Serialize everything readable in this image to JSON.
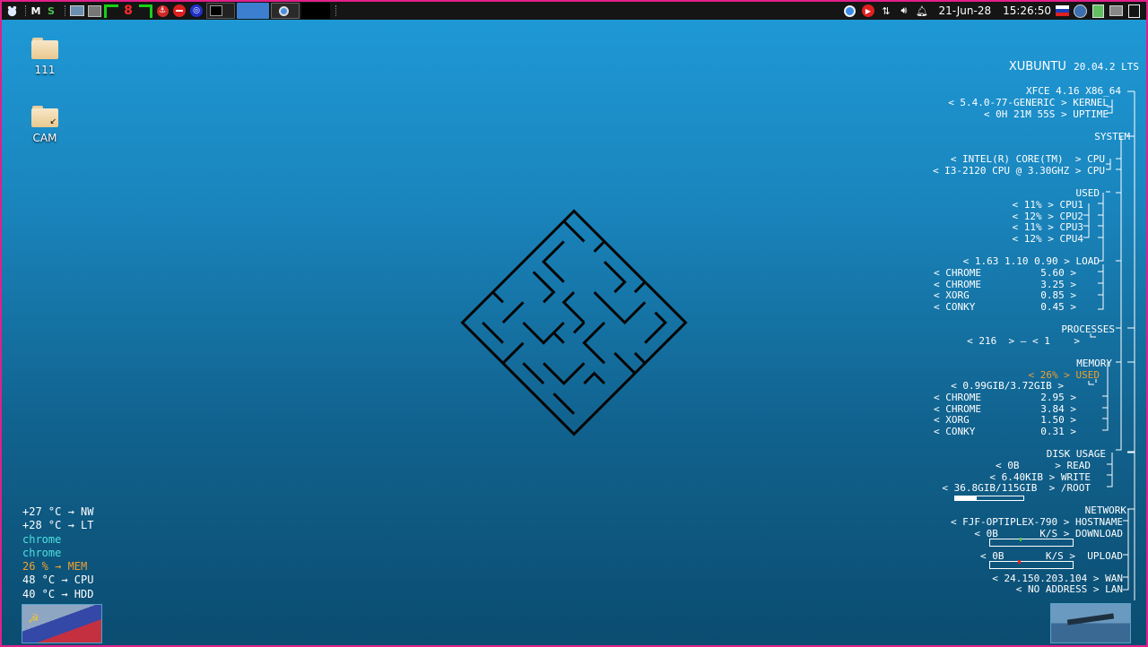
{
  "panel": {
    "menu_icon": "xfce-mouse-icon",
    "launcher_text": "M",
    "clock_date": "21-Jun-28",
    "clock_time": "15:26:50",
    "tray_icons": [
      "chrome-icon",
      "youtube-icon",
      "network-arrows-icon",
      "volume-icon",
      "bell-icon"
    ]
  },
  "desktop": {
    "icons": [
      {
        "label": "111"
      },
      {
        "label": "CAM"
      }
    ]
  },
  "conky": {
    "os_name": "XUBUNTU",
    "os_version": "20.04.2 LTS",
    "de": "XFCE 4.16 X86_64",
    "kernel": "< 5.4.0-77-GENERIC > KERNEL",
    "uptime": "< 0H 21M 55S > UPTIME",
    "system_h": "SYSTEM",
    "cpu1": "< INTEL(R) CORE(TM)  > CPU",
    "cpu2": "< I3-2120 CPU @ 3.30GHZ > CPU",
    "used_h": "USED",
    "cores": [
      "< 11% > CPU1",
      "< 12% > CPU2",
      "< 11% > CPU3",
      "< 12% > CPU4"
    ],
    "load": "< 1.63 1.10 0.90 > LOAD",
    "cpu_procs": [
      "< CHROME          5.60 >",
      "< CHROME          3.25 >",
      "< XORG            0.85 >",
      "< CONKY           0.45 >"
    ],
    "processes_h": "PROCESSES",
    "processes": "< 216  > – < 1    >",
    "memory_h": "MEMORY",
    "mem_used": "< 26% > USED",
    "mem_amount": "< 0.99GIB/3.72GIB >",
    "mem_procs": [
      "< CHROME          2.95 >",
      "< CHROME          3.84 >",
      "< XORG            1.50 >",
      "< CONKY           0.31 >"
    ],
    "disk_h": "DISK USAGE",
    "disk_read": "< 0B      > READ",
    "disk_write": "< 6.40KIB > WRITE",
    "disk_root": "< 36.8GIB/115GIB  > /ROOT",
    "disk_fraction": 0.32,
    "network_h": "NETWORK",
    "hostname": "< FJF-OPTIPLEX-790 > HOSTNAME",
    "download": "< 0B       K/S > DOWNLOAD",
    "upload": "< 0B       K/S >  UPLOAD",
    "wan": "< 24.150.203.104 > WAN",
    "lan": "< NO ADDRESS > LAN"
  },
  "left_conky": [
    {
      "text": "+27 °C →  NW",
      "color": "#ffffff"
    },
    {
      "text": "+28 °C →  LT",
      "color": "#ffffff"
    },
    {
      "text": "chrome",
      "color": "#4ee0e0"
    },
    {
      "text": "chrome",
      "color": "#4ee0e0"
    },
    {
      "text": "26 %  →  MEM",
      "color": "#f0a030"
    },
    {
      "text": "48 °C →  CPU",
      "color": "#ffffff"
    },
    {
      "text": "40 °C →  HDD",
      "color": "#ffffff"
    }
  ],
  "colors": {
    "frame": "#e0208a",
    "accent_orange": "#f0a030",
    "accent_cyan": "#4ee0e0"
  }
}
